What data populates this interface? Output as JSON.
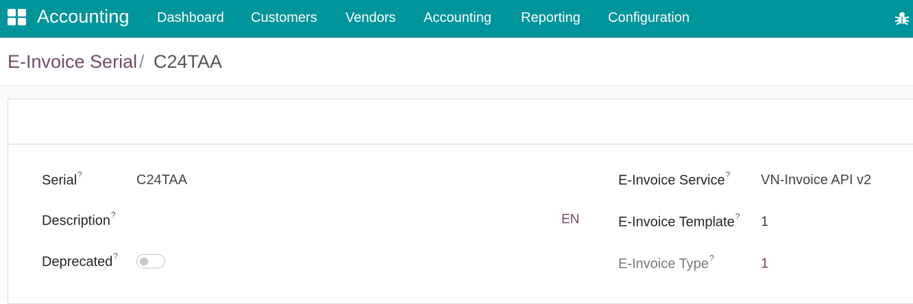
{
  "navbar": {
    "brand": "Accounting",
    "menu": [
      "Dashboard",
      "Customers",
      "Vendors",
      "Accounting",
      "Reporting",
      "Configuration"
    ],
    "apps_icon": "apps-grid-icon",
    "debug_icon": "bug-icon"
  },
  "breadcrumb": {
    "parent": "E-Invoice Serial",
    "separator": "/",
    "current": "C24TAA"
  },
  "form": {
    "left": {
      "serial_label": "Serial",
      "serial_value": "C24TAA",
      "description_label": "Description",
      "description_value": "",
      "description_lang": "EN",
      "deprecated_label": "Deprecated",
      "deprecated_value": false
    },
    "right": {
      "service_label": "E-Invoice Service",
      "service_value": "VN-Invoice API v2",
      "template_label": "E-Invoice Template",
      "template_value": "1",
      "type_label": "E-Invoice Type",
      "type_value": "1"
    },
    "help_marker": "?"
  },
  "colors": {
    "navbar": "#00949b",
    "link": "#714b67"
  }
}
